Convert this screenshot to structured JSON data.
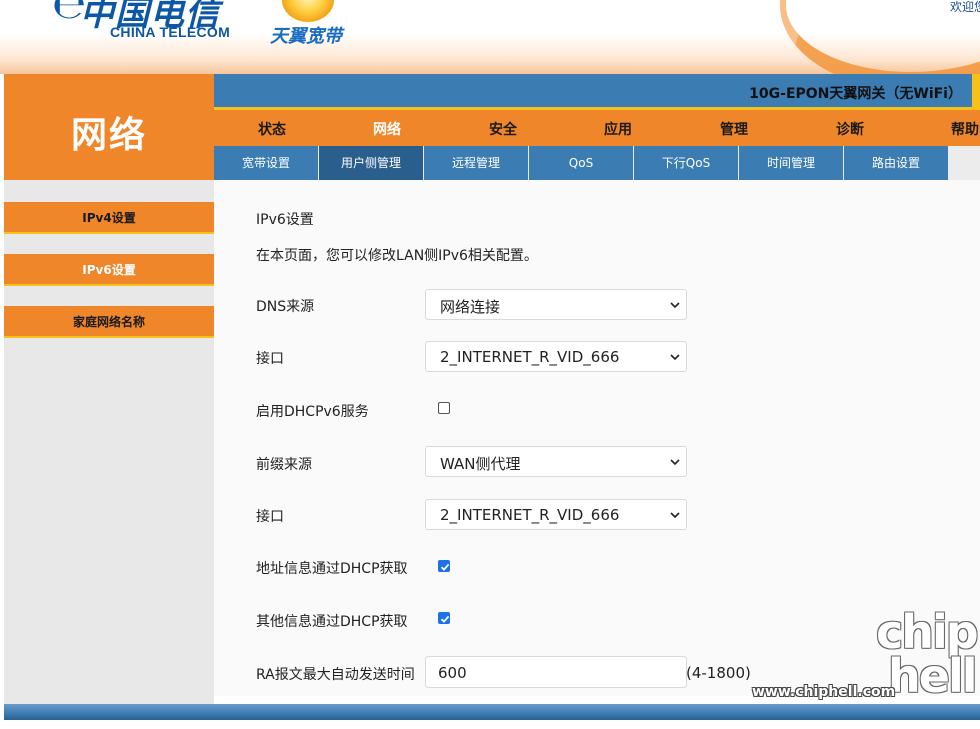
{
  "header": {
    "logo_ct_cn": "中国电信",
    "logo_ct_en": "CHINA TELECOM",
    "logo_ty": "天翼宽带",
    "welcome": "欢迎您"
  },
  "section_title": "网络",
  "model_name": "10G-EPON天翼网关（无WiFi）",
  "main_nav": [
    {
      "label": "状态"
    },
    {
      "label": "网络"
    },
    {
      "label": "安全"
    },
    {
      "label": "应用"
    },
    {
      "label": "管理"
    },
    {
      "label": "诊断"
    },
    {
      "label": "帮助"
    }
  ],
  "sub_nav": [
    {
      "label": "宽带设置"
    },
    {
      "label": "用户侧管理"
    },
    {
      "label": "远程管理"
    },
    {
      "label": "QoS"
    },
    {
      "label": "下行QoS"
    },
    {
      "label": "时间管理"
    },
    {
      "label": "路由设置"
    }
  ],
  "sidebar": [
    {
      "label": "IPv4设置"
    },
    {
      "label": "IPv6设置"
    },
    {
      "label": "家庭网络名称"
    }
  ],
  "content": {
    "heading": "IPv6设置",
    "description": "在本页面，您可以修改LAN侧IPv6相关配置。",
    "dns_source_label": "DNS来源",
    "dns_source_value": "网络连接",
    "interface1_label": "接口",
    "interface1_value": "2_INTERNET_R_VID_666",
    "dhcpv6_label": "启用DHCPv6服务",
    "dhcpv6_checked": false,
    "prefix_source_label": "前缀来源",
    "prefix_source_value": "WAN侧代理",
    "interface2_label": "接口",
    "interface2_value": "2_INTERNET_R_VID_666",
    "addr_dhcp_label": "地址信息通过DHCP获取",
    "addr_dhcp_checked": true,
    "other_dhcp_label": "其他信息通过DHCP获取",
    "other_dhcp_checked": true,
    "ra_label": "RA报文最大自动发送时间",
    "ra_value": "600",
    "ra_range": "(4-1800)"
  },
  "watermark": {
    "line1": "chip",
    "line2": "hell",
    "url": "www.chiphell.com"
  },
  "colors": {
    "orange": "#f0862a",
    "blue": "#3b7cb3",
    "yellow": "#f6c21a",
    "checkbox": "#1a73e8"
  }
}
